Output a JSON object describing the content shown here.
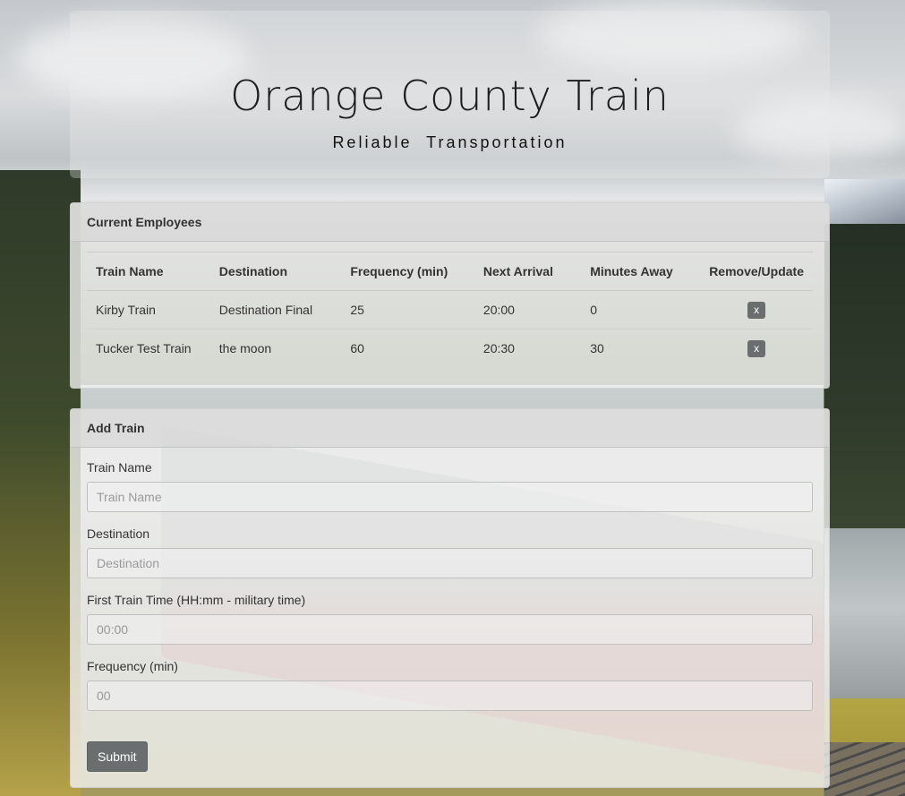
{
  "header": {
    "title": "Orange County Train",
    "subtitle": "Reliable Transportation"
  },
  "schedule": {
    "heading": "Current Employees",
    "columns": [
      "Train Name",
      "Destination",
      "Frequency (min)",
      "Next Arrival",
      "Minutes Away",
      "Remove/Update"
    ],
    "rows": [
      {
        "name": "Kirby Train",
        "destination": "Destination Final",
        "frequency": "25",
        "next_arrival": "20:00",
        "minutes_away": "0",
        "action_label": "x"
      },
      {
        "name": "Tucker Test Train",
        "destination": "the moon",
        "frequency": "60",
        "next_arrival": "20:30",
        "minutes_away": "30",
        "action_label": "x"
      }
    ]
  },
  "add_train": {
    "heading": "Add Train",
    "fields": [
      {
        "label": "Train Name",
        "placeholder": "Train Name",
        "value": ""
      },
      {
        "label": "Destination",
        "placeholder": "Destination",
        "value": ""
      },
      {
        "label": "First Train Time (HH:mm - military time)",
        "placeholder": "00:00",
        "value": ""
      },
      {
        "label": "Frequency (min)",
        "placeholder": "00",
        "value": ""
      }
    ],
    "submit_label": "Submit"
  },
  "colors": {
    "button_bg": "#6b6e6e",
    "heading_text": "#333333"
  }
}
